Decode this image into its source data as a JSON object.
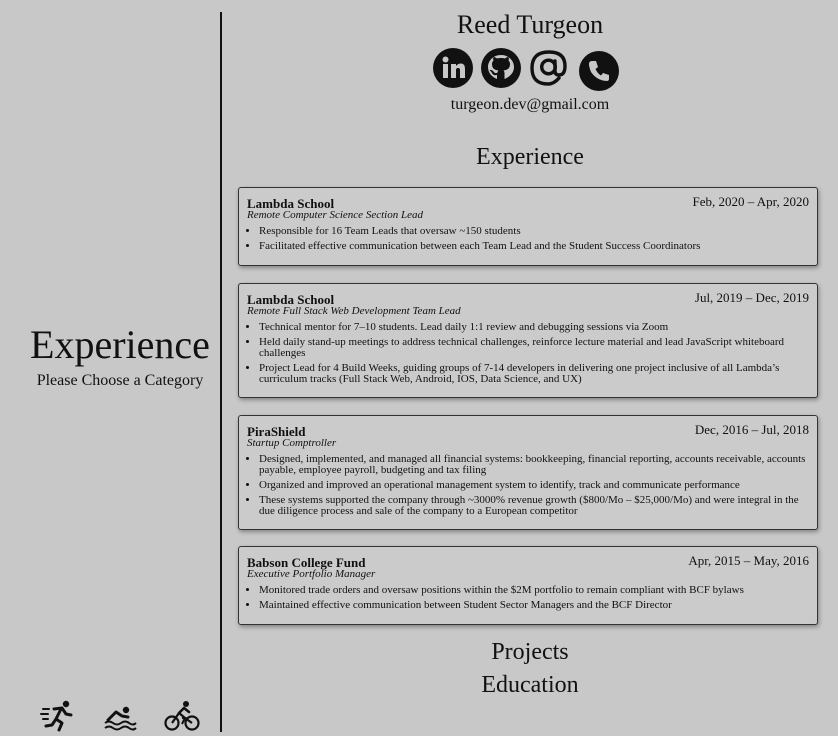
{
  "sidebar": {
    "title": "Experience",
    "subtitle": "Please Choose a Category",
    "icons": [
      "running-icon",
      "swimming-icon",
      "cycling-icon"
    ]
  },
  "header": {
    "name": "Reed Turgeon",
    "contact_icons": [
      "linkedin-icon",
      "github-icon",
      "email-at-icon",
      "phone-icon"
    ],
    "email": "turgeon.dev@gmail.com"
  },
  "sections": {
    "experience": "Experience",
    "projects": "Projects",
    "education": "Education"
  },
  "experience": [
    {
      "company": "Lambda School",
      "dates": "Feb, 2020 – Apr, 2020",
      "role": "Remote Computer Science Section Lead",
      "bullets": [
        "Responsible for 16 Team Leads that oversaw ~150 students",
        "Facilitated effective communication between each Team Lead and the Student Success Coordinators"
      ]
    },
    {
      "company": "Lambda School",
      "dates": "Jul, 2019 – Dec, 2019",
      "role": "Remote Full Stack Web Development Team Lead",
      "bullets": [
        "Technical mentor for 7–10 students. Lead daily 1:1 review and debugging sessions via Zoom",
        "Held daily stand-up meetings to address technical challenges, reinforce lecture material and lead JavaScript whiteboard challenges",
        "Project Lead for 4 Build Weeks, guiding groups of 7-14 developers in delivering one project inclusive of all Lambda’s curriculum tracks (Full Stack Web, Android, IOS, Data Science, and UX)"
      ]
    },
    {
      "company": "PiraShield",
      "dates": "Dec, 2016 – Jul, 2018",
      "role": "Startup Comptroller",
      "bullets": [
        "Designed, implemented, and managed all financial systems: bookkeeping, financial reporting, accounts receivable, accounts payable, employee payroll, budgeting and tax filing",
        "Organized and improved an operational management system to identify, track and communicate performance",
        "These systems supported the company through ~3000% revenue growth ($800/Mo – $25,000/Mo) and were integral in the due diligence process and sale of the company to a European competitor"
      ]
    },
    {
      "company": "Babson College Fund",
      "dates": "Apr, 2015 – May, 2016",
      "role": "Executive Portfolio Manager",
      "bullets": [
        "Monitored trade orders and oversaw positions within the $2M portfolio to remain compliant with BCF bylaws",
        "Maintained effective communication between Student Sector Managers and the BCF Director"
      ]
    }
  ]
}
